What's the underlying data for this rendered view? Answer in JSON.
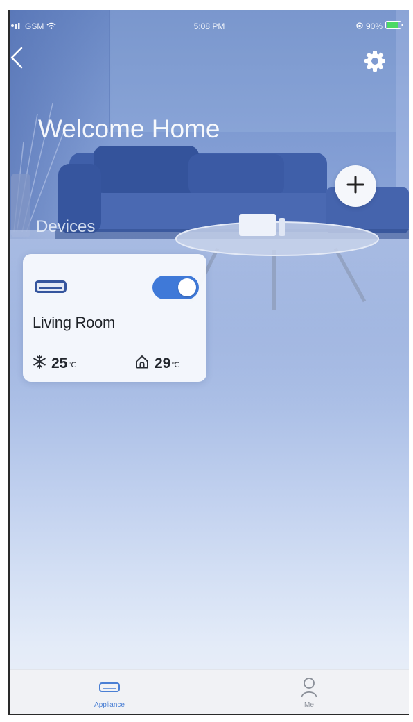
{
  "status_bar": {
    "carrier": "GSM",
    "time": "5:08 PM",
    "battery": "90%",
    "icons": [
      "signal-icon",
      "wifi-icon",
      "orientation-lock-icon",
      "battery-icon"
    ]
  },
  "header": {
    "back_icon": "chevron-left-icon",
    "settings_icon": "gear-icon"
  },
  "welcome_title": "Welcome Home",
  "add_device_button": {
    "icon": "plus-icon"
  },
  "devices_section": {
    "title": "Devices",
    "items": [
      {
        "name": "Living Room",
        "icon": "air-conditioner-icon",
        "power_on": true,
        "set_temperature": "25",
        "set_temperature_unit": "℃",
        "set_temperature_icon": "snowflake-icon",
        "indoor_temperature": "29",
        "indoor_temperature_unit": "℃",
        "indoor_temperature_icon": "home-icon"
      }
    ]
  },
  "tab_bar": {
    "tabs": [
      {
        "label": "Appliance",
        "icon": "air-conditioner-icon",
        "active": true
      },
      {
        "label": "Me",
        "icon": "person-icon",
        "active": false
      }
    ]
  },
  "colors": {
    "accent": "#3f79d8",
    "tab_active": "#4a7fd4",
    "tab_inactive": "#8a8f98",
    "card_background": "#f8fafd",
    "text_primary": "#1f2329",
    "sofa": "#3f5fa9"
  }
}
